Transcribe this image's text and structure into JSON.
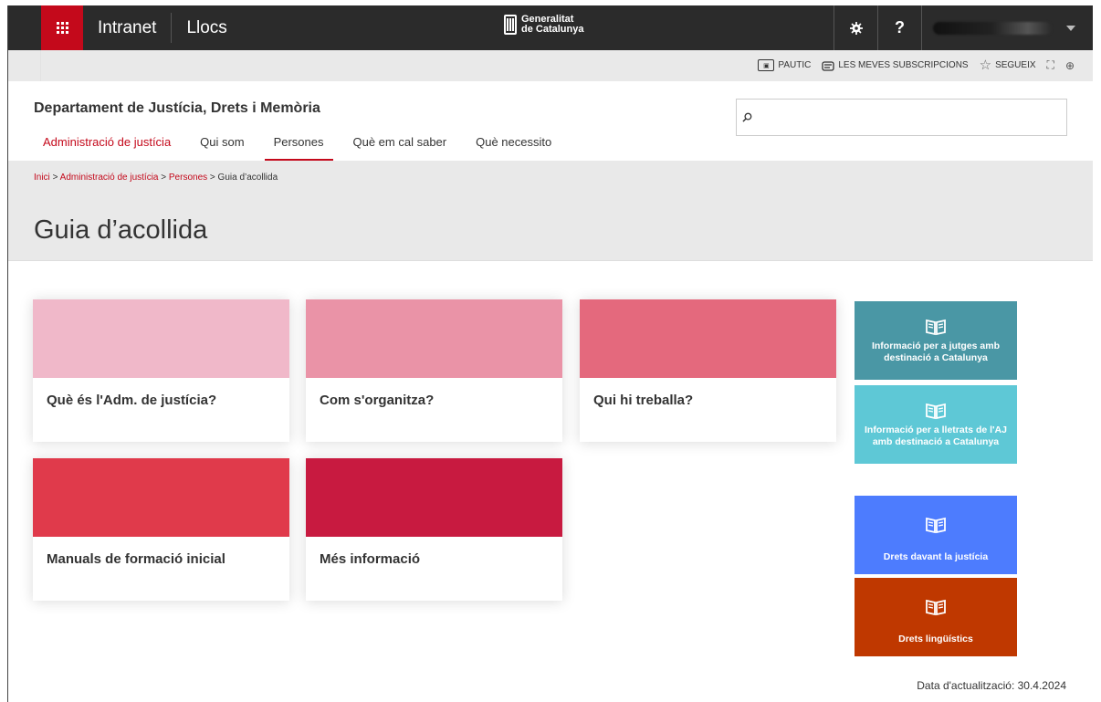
{
  "topbar": {
    "intranet_label": "Intranet",
    "llocs_label": "Llocs",
    "brand_line1": "Generalitat",
    "brand_line2": "de Catalunya",
    "help_label": "?"
  },
  "utilbar": {
    "pautic_label": "PAUTIC",
    "subscriptions_label": "LES MEVES SUBSCRIPCIONS",
    "follow_label": "SEGUEIX"
  },
  "header": {
    "department": "Departament de Justícia, Drets i Memòria",
    "nav": [
      {
        "label": "Administració de justícia"
      },
      {
        "label": "Qui som"
      },
      {
        "label": "Persones"
      },
      {
        "label": "Què em cal saber"
      },
      {
        "label": "Què necessito"
      }
    ]
  },
  "breadcrumb": {
    "items": [
      "Inici",
      "Administració de justícia",
      "Persones"
    ],
    "current": "Guia d’acollida",
    "separator": ">"
  },
  "page": {
    "title": "Guia d’acollida",
    "updated": "Data d'actualització: 30.4.2024"
  },
  "cards": [
    {
      "title": "Què és l'Adm. de justícia?",
      "color": "#f0b8c9"
    },
    {
      "title": "Com s'organitza?",
      "color": "#ea93a7"
    },
    {
      "title": "Qui hi treballa?",
      "color": "#e4697d"
    },
    {
      "title": "Manuals de formació inicial",
      "color": "#e03a4b"
    },
    {
      "title": "Més informació",
      "color": "#c81a40"
    }
  ],
  "tiles": [
    {
      "label": "Informació per a jutges amb destinació a Catalunya",
      "color": "#4a97a5",
      "icon": "book-icon"
    },
    {
      "label": "Informació per a lletrats de l'AJ amb destinació a Catalunya",
      "color": "#5ec8d6",
      "icon": "book-icon"
    },
    {
      "label": "Drets davant la justícia",
      "color": "#4d7cfe",
      "icon": "book-icon"
    },
    {
      "label": "Drets lingüístics",
      "color": "#bf3800",
      "icon": "book-icon"
    }
  ],
  "colors": {
    "accent": "#c4091b",
    "topbar": "#2b2b2b",
    "band": "#e9e9e9"
  }
}
